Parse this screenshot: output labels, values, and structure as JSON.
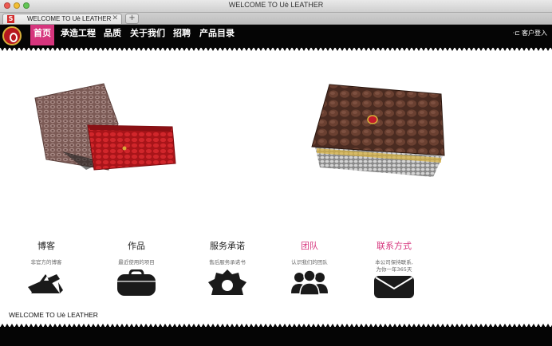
{
  "window": {
    "title": "WELCOME TO Uè LEATHER"
  },
  "tab": {
    "favicon": "S",
    "title": "WELCOME TO Uè LEATHER",
    "close": "✕",
    "new_tab": "+"
  },
  "nav": {
    "items": [
      "首页",
      "承造工程",
      "品质",
      "关于我们",
      "招聘",
      "产品目录"
    ],
    "active_index": 0,
    "login_icon": "·⊏",
    "login": "客户登入"
  },
  "features": [
    {
      "title": "博客",
      "subtitle": "非官方的博客",
      "icon": "ruler-pencil-icon"
    },
    {
      "title": "作品",
      "subtitle": "最近使用的项目",
      "icon": "briefcase-icon"
    },
    {
      "title": "服务承诺",
      "subtitle": "售后服务承诺书",
      "icon": "gear-icon"
    },
    {
      "title": "团队",
      "subtitle": "认识我们的团队",
      "icon": "team-icon",
      "highlight": true
    },
    {
      "title": "联系方式",
      "subtitle": "本公司保持联系,",
      "subtitle2": "为你一年365天",
      "icon": "envelope-icon",
      "highlight": true
    }
  ],
  "footer": {
    "text": "WELCOME TO Uè LEATHER"
  },
  "colors": {
    "accent": "#d6357d",
    "nav_bg": "#050505",
    "logo_red": "#b7171f"
  }
}
